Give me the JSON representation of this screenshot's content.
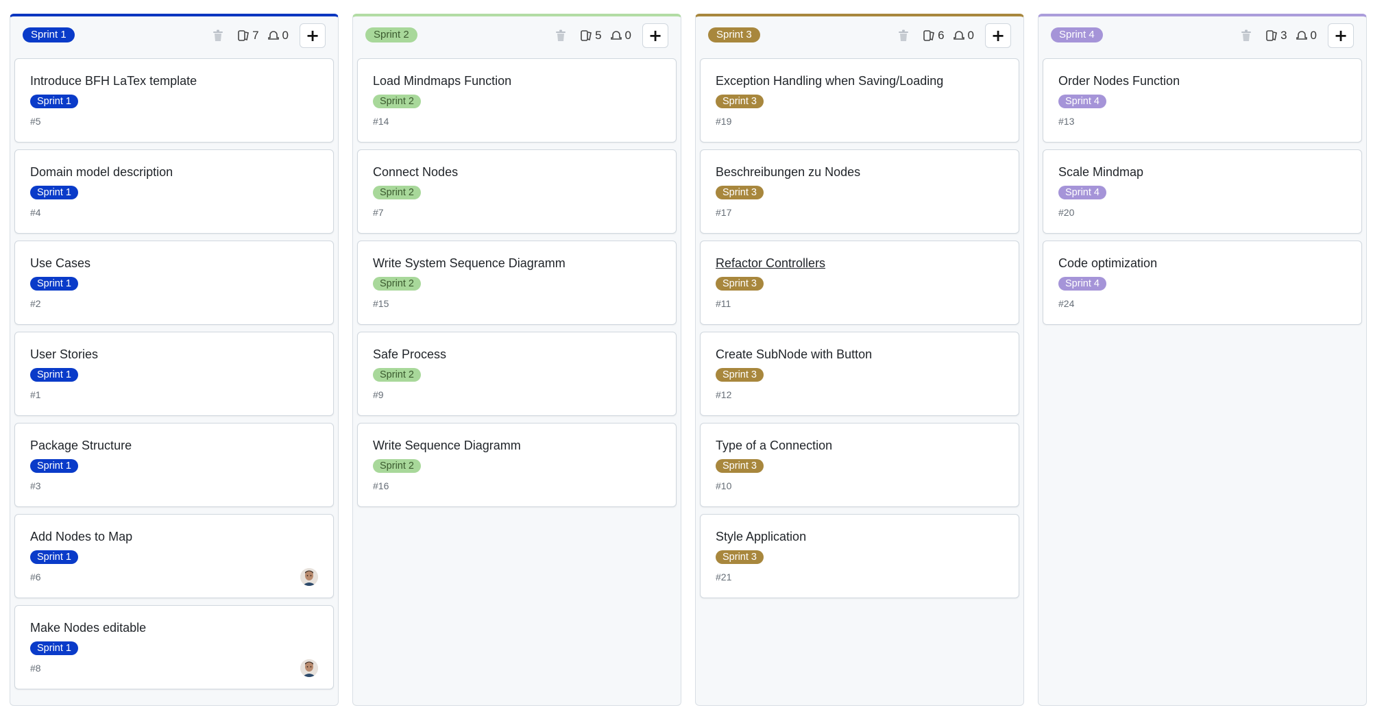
{
  "colors": {
    "sprint1_bg": "#0a3bc9",
    "sprint1_text": "#ffffff",
    "sprint2_bg": "#a8d89a",
    "sprint2_text": "#3b5a2f",
    "sprint3_bg": "#a8873d",
    "sprint3_text": "#ffffff",
    "sprint4_bg": "#a594d8",
    "sprint4_text": "#ffffff",
    "sprint1_top": "#0a36c0",
    "sprint2_top": "#b2dca4",
    "sprint3_top": "#a8873d",
    "sprint4_top": "#ab9ddb"
  },
  "icons": {
    "trash": "trash-icon",
    "issues": "issue-count-icon",
    "milestone": "points-icon",
    "add": "plus-icon"
  },
  "columns": [
    {
      "label": "Sprint 1",
      "issue_count": "7",
      "point_count": "0",
      "add_label": "+",
      "cards": [
        {
          "title": "Introduce BFH LaTex template",
          "label": "Sprint 1",
          "number": "#5",
          "avatar": false
        },
        {
          "title": "Domain model description",
          "label": "Sprint 1",
          "number": "#4",
          "avatar": false
        },
        {
          "title": "Use Cases",
          "label": "Sprint 1",
          "number": "#2",
          "avatar": false
        },
        {
          "title": "User Stories",
          "label": "Sprint 1",
          "number": "#1",
          "avatar": false
        },
        {
          "title": "Package Structure",
          "label": "Sprint 1",
          "number": "#3",
          "avatar": false
        },
        {
          "title": "Add Nodes to Map",
          "label": "Sprint 1",
          "number": "#6",
          "avatar": true
        },
        {
          "title": "Make Nodes editable",
          "label": "Sprint 1",
          "number": "#8",
          "avatar": true
        }
      ]
    },
    {
      "label": "Sprint 2",
      "issue_count": "5",
      "point_count": "0",
      "add_label": "+",
      "cards": [
        {
          "title": "Load Mindmaps Function",
          "label": "Sprint 2",
          "number": "#14",
          "avatar": false
        },
        {
          "title": "Connect Nodes",
          "label": "Sprint 2",
          "number": "#7",
          "avatar": false
        },
        {
          "title": "Write System Sequence Diagramm",
          "label": "Sprint 2",
          "number": "#15",
          "avatar": false
        },
        {
          "title": "Safe Process",
          "label": "Sprint 2",
          "number": "#9",
          "avatar": false
        },
        {
          "title": "Write Sequence Diagramm",
          "label": "Sprint 2",
          "number": "#16",
          "avatar": false
        }
      ]
    },
    {
      "label": "Sprint 3",
      "issue_count": "6",
      "point_count": "0",
      "add_label": "+",
      "cards": [
        {
          "title": "Exception Handling when Saving/Loading",
          "label": "Sprint 3",
          "number": "#19",
          "avatar": false
        },
        {
          "title": "Beschreibungen zu Nodes",
          "label": "Sprint 3",
          "number": "#17",
          "avatar": false
        },
        {
          "title": "Refactor Controllers",
          "label": "Sprint 3",
          "number": "#11",
          "avatar": false,
          "underlined": true
        },
        {
          "title": "Create SubNode with Button",
          "label": "Sprint 3",
          "number": "#12",
          "avatar": false
        },
        {
          "title": "Type of a Connection",
          "label": "Sprint 3",
          "number": "#10",
          "avatar": false
        },
        {
          "title": "Style Application",
          "label": "Sprint 3",
          "number": "#21",
          "avatar": false
        }
      ]
    },
    {
      "label": "Sprint 4",
      "issue_count": "3",
      "point_count": "0",
      "add_label": "+",
      "cards": [
        {
          "title": "Order Nodes Function",
          "label": "Sprint 4",
          "number": "#13",
          "avatar": false
        },
        {
          "title": "Scale Mindmap",
          "label": "Sprint 4",
          "number": "#20",
          "avatar": false
        },
        {
          "title": "Code optimization",
          "label": "Sprint 4",
          "number": "#24",
          "avatar": false
        }
      ]
    }
  ]
}
